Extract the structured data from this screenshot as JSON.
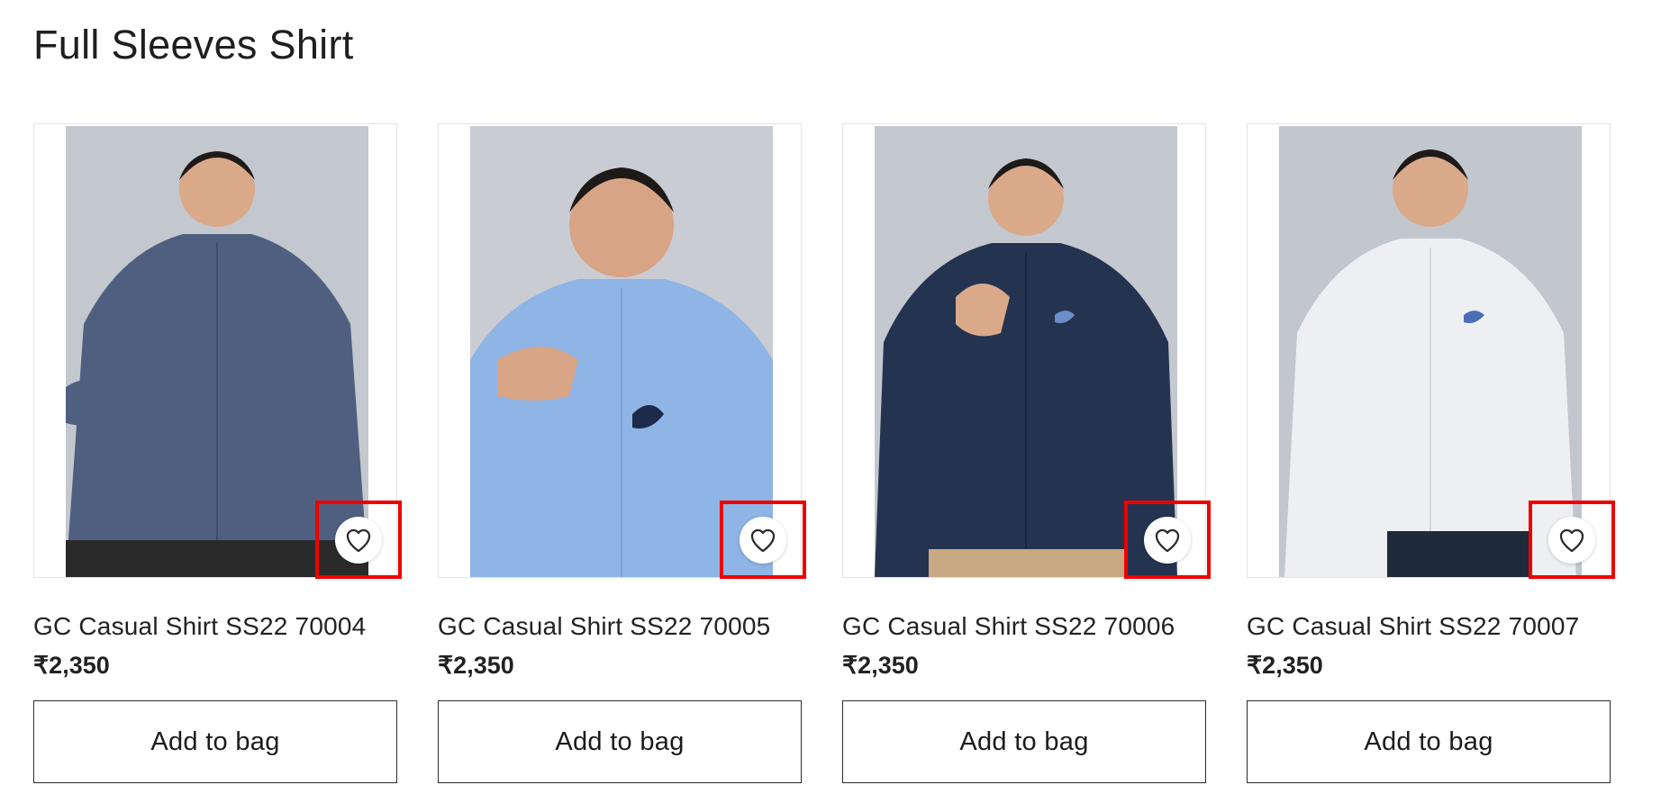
{
  "section": {
    "title": "Full Sleeves Shirt"
  },
  "products": [
    {
      "name": "GC Casual Shirt SS22 70004",
      "price": "₹2,350",
      "add_label": "Add to bag",
      "wishlist_icon": "heart-outline-icon",
      "shirt_color": "#4f5f7f",
      "image_alt": "Man wearing blue textured full sleeve shirt"
    },
    {
      "name": "GC Casual Shirt SS22 70005",
      "price": "₹2,350",
      "add_label": "Add to bag",
      "wishlist_icon": "heart-outline-icon",
      "shirt_color": "#8fb4e6",
      "image_alt": "Man wearing light blue full sleeve shirt"
    },
    {
      "name": "GC Casual Shirt SS22 70006",
      "price": "₹2,350",
      "add_label": "Add to bag",
      "wishlist_icon": "heart-outline-icon",
      "shirt_color": "#243450",
      "image_alt": "Man wearing navy full sleeve shirt"
    },
    {
      "name": "GC Casual Shirt SS22 70007",
      "price": "₹2,350",
      "add_label": "Add to bag",
      "wishlist_icon": "heart-outline-icon",
      "shirt_color": "#eeeff2",
      "image_alt": "Man wearing white full sleeve shirt"
    }
  ],
  "colors": {
    "highlight": "#ee0000",
    "text": "#1b1b1b"
  }
}
